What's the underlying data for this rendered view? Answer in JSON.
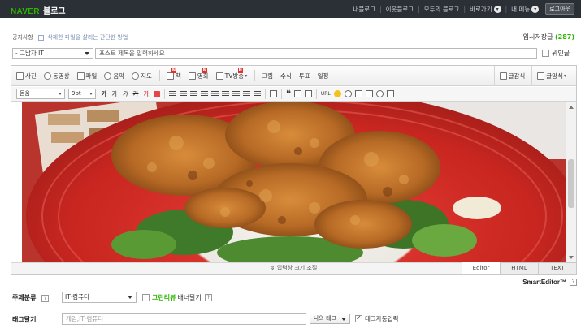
{
  "header": {
    "brand": "NAVER",
    "product": "블로그",
    "nav": [
      "내블로그",
      "이웃블로그",
      "모두의 블로그"
    ],
    "shortcut_label": "바로가기",
    "my_menu_label": "내 메뉴",
    "logout_label": "로그아웃"
  },
  "notice": {
    "label": "공지사항",
    "tip": "삭제한 파일을 살리는 간단한 방법"
  },
  "drafts": {
    "label": "임시저장글",
    "count": "(287)"
  },
  "post": {
    "category": "- 그남자 IT",
    "title_placeholder": "포스트 제목을 입력하세요",
    "title_value": "",
    "notice_checkbox_label": "뭐인글"
  },
  "toolbar1": {
    "items": [
      "사진",
      "동영상",
      "파일",
      "음악",
      "지도",
      "책",
      "영화",
      "TV방송",
      "그림",
      "수식",
      "투표",
      "일정"
    ],
    "right": [
      "글감식",
      "글양식"
    ]
  },
  "toolbar2": {
    "font": "돋움",
    "size": "9pt",
    "buttons": [
      "가",
      "가",
      "가",
      "가",
      "가"
    ],
    "quote": "❝",
    "text_url": "URL"
  },
  "editor": {
    "resize_label": "⇕ 입력창 크기 조절",
    "modes": [
      "Editor",
      "HTML",
      "TEXT"
    ],
    "brand": "SmartEditor™"
  },
  "subject": {
    "label": "주제분류",
    "value": "IT·컴퓨터",
    "green_label": "그린리뷰",
    "green_suffix": "배너달기"
  },
  "tags": {
    "label": "태그달기",
    "placeholder": "게임,IT·컴퓨터",
    "mytag_label": "나의 태그",
    "auto_label": "태그자동입력"
  },
  "colors": {
    "brand_green": "#2db400",
    "topbar": "#2b2f36"
  }
}
